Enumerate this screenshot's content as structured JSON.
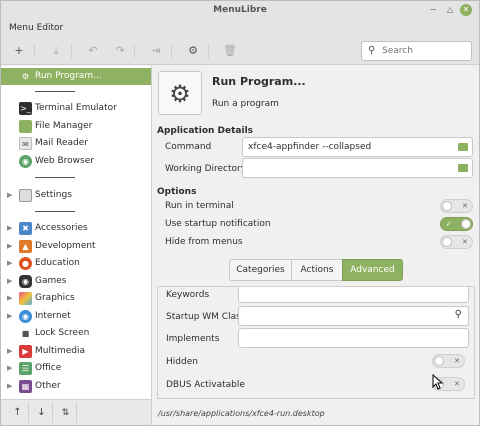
{
  "window": {
    "title": "MenuLibre"
  },
  "menubar": {
    "label": "Menu Editor"
  },
  "search": {
    "placeholder": "Search"
  },
  "sidebar": {
    "items": [
      {
        "label": "Run Program...",
        "selected": true,
        "icon": "gear-icon"
      },
      {
        "label": "Terminal Emulator",
        "icon": "terminal-icon"
      },
      {
        "label": "File Manager",
        "icon": "folder-icon"
      },
      {
        "label": "Mail Reader",
        "icon": "mail-icon"
      },
      {
        "label": "Web Browser",
        "icon": "globe-icon"
      },
      {
        "label": "Settings",
        "icon": "settings-icon"
      },
      {
        "label": "Accessories",
        "icon": "accessories-icon"
      },
      {
        "label": "Development",
        "icon": "development-icon"
      },
      {
        "label": "Education",
        "icon": "education-icon"
      },
      {
        "label": "Games",
        "icon": "games-icon"
      },
      {
        "label": "Graphics",
        "icon": "graphics-icon"
      },
      {
        "label": "Internet",
        "icon": "internet-icon"
      },
      {
        "label": "Lock Screen",
        "icon": "lock-icon"
      },
      {
        "label": "Multimedia",
        "icon": "multimedia-icon"
      },
      {
        "label": "Office",
        "icon": "office-icon"
      },
      {
        "label": "Other",
        "icon": "other-icon"
      }
    ]
  },
  "app": {
    "name": "Run Program...",
    "comment": "Run a program"
  },
  "details": {
    "heading": "Application Details",
    "command_label": "Command",
    "command_value": "xfce4-appfinder --collapsed",
    "workdir_label": "Working Directory",
    "workdir_value": ""
  },
  "options": {
    "heading": "Options",
    "run_in_terminal_label": "Run in terminal",
    "run_in_terminal": false,
    "startup_notification_label": "Use startup notification",
    "startup_notification": true,
    "hide_from_menus_label": "Hide from menus",
    "hide_from_menus": false
  },
  "tabs": [
    {
      "label": "Categories",
      "active": false
    },
    {
      "label": "Actions",
      "active": false
    },
    {
      "label": "Advanced",
      "active": true
    }
  ],
  "advanced": {
    "keywords_label": "Keywords",
    "startup_wm_class_label": "Startup WM Class",
    "implements_label": "Implements",
    "hidden_label": "Hidden",
    "hidden": false,
    "dbus_label": "DBUS Activatable",
    "dbus": false
  },
  "footer": {
    "path": "/usr/share/applications/xfce4-run.desktop"
  },
  "colors": {
    "accent": "#8fb162"
  }
}
